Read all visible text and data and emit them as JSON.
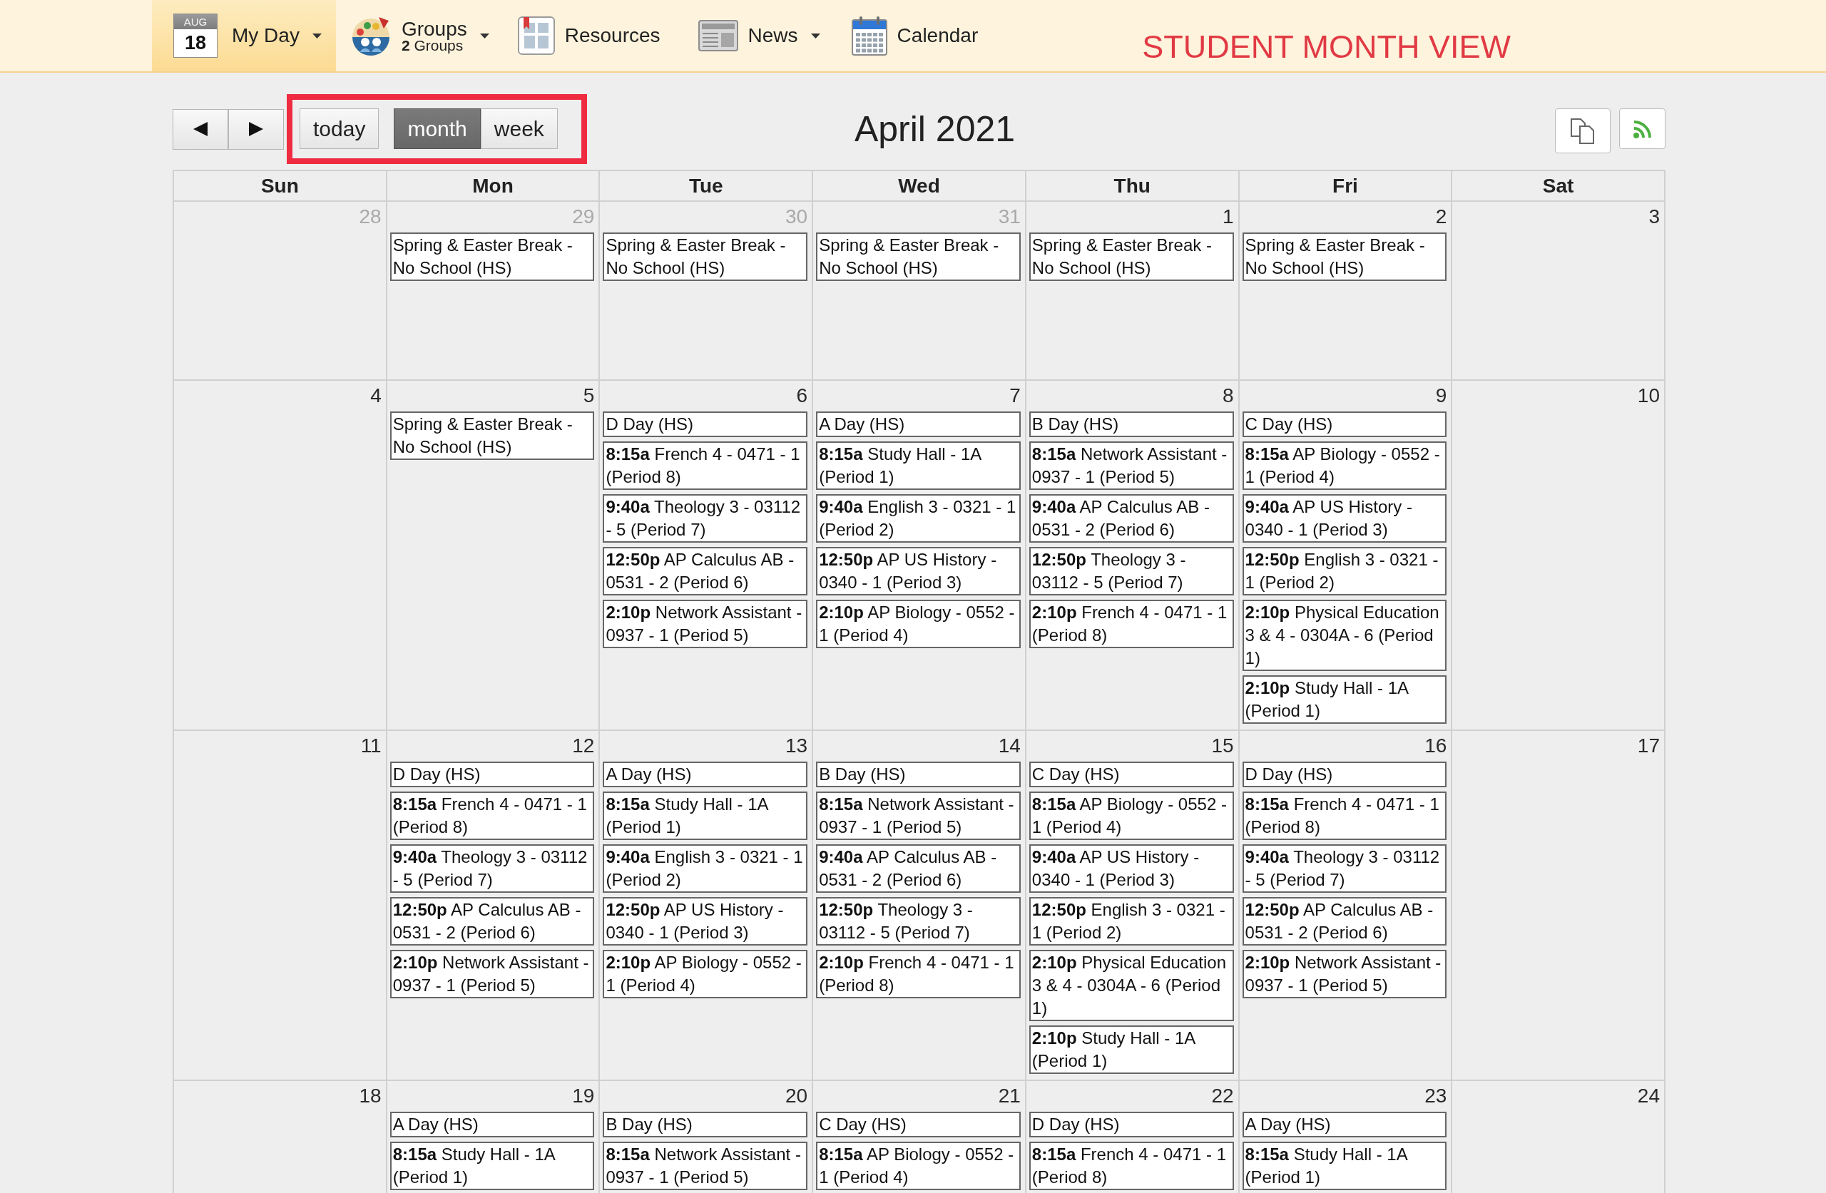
{
  "nav": [
    {
      "kind": "date",
      "badge_month": "AUG",
      "badge_day": "18",
      "label": "My Day",
      "dropdown": true,
      "selected": true
    },
    {
      "kind": "groups",
      "label": "Groups",
      "sublabel": "**2** Groups",
      "dropdown": true,
      "selected": false
    },
    {
      "kind": "resources",
      "label": "Resources",
      "dropdown": false,
      "selected": false
    },
    {
      "kind": "news",
      "label": "News",
      "dropdown": true,
      "selected": false
    },
    {
      "kind": "calendar",
      "label": "Calendar",
      "dropdown": false,
      "selected": false
    }
  ],
  "page_label": "STUDENT MONTH VIEW",
  "toolbar": {
    "today": "today",
    "views": [
      {
        "label": "month",
        "selected": true
      },
      {
        "label": "week",
        "selected": false
      }
    ],
    "highlighted": true,
    "title": "April 2021",
    "tools": [
      {
        "kind": "copy"
      },
      {
        "kind": "feed"
      }
    ]
  },
  "calendar": {
    "weekdays": [
      "Sun",
      "Mon",
      "Tue",
      "Wed",
      "Thu",
      "Fri",
      "Sat"
    ],
    "weeks": [
      {
        "days": [
          {
            "number": "28",
            "other_month": true
          },
          {
            "number": "29",
            "other_month": true,
            "events": [
              {
                "title": "Spring & Easter Break - No School (HS)"
              }
            ]
          },
          {
            "number": "30",
            "other_month": true,
            "events": [
              {
                "title": "Spring & Easter Break - No School (HS)"
              }
            ]
          },
          {
            "number": "31",
            "other_month": true,
            "events": [
              {
                "title": "Spring & Easter Break - No School (HS)"
              }
            ]
          },
          {
            "number": "1",
            "other_month": false,
            "events": [
              {
                "title": "Spring & Easter Break - No School (HS)"
              }
            ]
          },
          {
            "number": "2",
            "other_month": false,
            "events": [
              {
                "title": "Spring & Easter Break - No School (HS)"
              }
            ]
          },
          {
            "number": "3",
            "other_month": false
          }
        ]
      },
      {
        "days": [
          {
            "number": "4",
            "other_month": false
          },
          {
            "number": "5",
            "other_month": false,
            "events": [
              {
                "title": "Spring & Easter Break - No School (HS)"
              }
            ]
          },
          {
            "number": "6",
            "other_month": false,
            "events": [
              {
                "title": "D Day (HS)"
              },
              {
                "time": "8:15a",
                "title": "French 4 - 0471 - 1 (Period 8)"
              },
              {
                "time": "9:40a",
                "title": "Theology 3 - 03112 - 5 (Period 7)"
              },
              {
                "time": "12:50p",
                "title": "AP Calculus AB - 0531 - 2 (Period 6)"
              },
              {
                "time": "2:10p",
                "title": "Network Assistant - 0937 - 1 (Period 5)"
              }
            ]
          },
          {
            "number": "7",
            "other_month": false,
            "events": [
              {
                "title": "A Day (HS)"
              },
              {
                "time": "8:15a",
                "title": "Study Hall - 1A (Period 1)"
              },
              {
                "time": "9:40a",
                "title": "English 3 - 0321 - 1 (Period 2)"
              },
              {
                "time": "12:50p",
                "title": "AP US History - 0340 - 1 (Period 3)"
              },
              {
                "time": "2:10p",
                "title": "AP Biology - 0552 - 1 (Period 4)"
              }
            ]
          },
          {
            "number": "8",
            "other_month": false,
            "events": [
              {
                "title": "B Day (HS)"
              },
              {
                "time": "8:15a",
                "title": "Network Assistant - 0937 - 1 (Period 5)"
              },
              {
                "time": "9:40a",
                "title": "AP Calculus AB - 0531 - 2 (Period 6)"
              },
              {
                "time": "12:50p",
                "title": "Theology 3 - 03112 - 5 (Period 7)"
              },
              {
                "time": "2:10p",
                "title": "French 4 - 0471 - 1 (Period 8)"
              }
            ]
          },
          {
            "number": "9",
            "other_month": false,
            "events": [
              {
                "title": "C Day (HS)"
              },
              {
                "time": "8:15a",
                "title": "AP Biology - 0552 - 1 (Period 4)"
              },
              {
                "time": "9:40a",
                "title": "AP US History - 0340 - 1 (Period 3)"
              },
              {
                "time": "12:50p",
                "title": "English 3 - 0321 - 1 (Period 2)"
              },
              {
                "time": "2:10p",
                "title": "Physical Education 3 & 4 - 0304A - 6 (Period 1)"
              },
              {
                "time": "2:10p",
                "title": "Study Hall - 1A (Period 1)"
              }
            ]
          },
          {
            "number": "10",
            "other_month": false
          }
        ]
      },
      {
        "days": [
          {
            "number": "11",
            "other_month": false
          },
          {
            "number": "12",
            "other_month": false,
            "events": [
              {
                "title": "D Day (HS)"
              },
              {
                "time": "8:15a",
                "title": "French 4 - 0471 - 1 (Period 8)"
              },
              {
                "time": "9:40a",
                "title": "Theology 3 - 03112 - 5 (Period 7)"
              },
              {
                "time": "12:50p",
                "title": "AP Calculus AB - 0531 - 2 (Period 6)"
              },
              {
                "time": "2:10p",
                "title": "Network Assistant - 0937 - 1 (Period 5)"
              }
            ]
          },
          {
            "number": "13",
            "other_month": false,
            "events": [
              {
                "title": "A Day (HS)"
              },
              {
                "time": "8:15a",
                "title": "Study Hall - 1A (Period 1)"
              },
              {
                "time": "9:40a",
                "title": "English 3 - 0321 - 1 (Period 2)"
              },
              {
                "time": "12:50p",
                "title": "AP US History - 0340 - 1 (Period 3)"
              },
              {
                "time": "2:10p",
                "title": "AP Biology - 0552 - 1 (Period 4)"
              }
            ]
          },
          {
            "number": "14",
            "other_month": false,
            "events": [
              {
                "title": "B Day (HS)"
              },
              {
                "time": "8:15a",
                "title": "Network Assistant - 0937 - 1 (Period 5)"
              },
              {
                "time": "9:40a",
                "title": "AP Calculus AB - 0531 - 2 (Period 6)"
              },
              {
                "time": "12:50p",
                "title": "Theology 3 - 03112 - 5 (Period 7)"
              },
              {
                "time": "2:10p",
                "title": "French 4 - 0471 - 1 (Period 8)"
              }
            ]
          },
          {
            "number": "15",
            "other_month": false,
            "events": [
              {
                "title": "C Day (HS)"
              },
              {
                "time": "8:15a",
                "title": "AP Biology - 0552 - 1 (Period 4)"
              },
              {
                "time": "9:40a",
                "title": "AP US History - 0340 - 1 (Period 3)"
              },
              {
                "time": "12:50p",
                "title": "English 3 - 0321 - 1 (Period 2)"
              },
              {
                "time": "2:10p",
                "title": "Physical Education 3 & 4 - 0304A - 6 (Period 1)"
              },
              {
                "time": "2:10p",
                "title": "Study Hall - 1A (Period 1)"
              }
            ]
          },
          {
            "number": "16",
            "other_month": false,
            "events": [
              {
                "title": "D Day (HS)"
              },
              {
                "time": "8:15a",
                "title": "French 4 - 0471 - 1 (Period 8)"
              },
              {
                "time": "9:40a",
                "title": "Theology 3 - 03112 - 5 (Period 7)"
              },
              {
                "time": "12:50p",
                "title": "AP Calculus AB - 0531 - 2 (Period 6)"
              },
              {
                "time": "2:10p",
                "title": "Network Assistant - 0937 - 1 (Period 5)"
              }
            ]
          },
          {
            "number": "17",
            "other_month": false
          }
        ]
      },
      {
        "days": [
          {
            "number": "18",
            "other_month": false
          },
          {
            "number": "19",
            "other_month": false,
            "events": [
              {
                "title": "A Day (HS)"
              },
              {
                "time": "8:15a",
                "title": "Study Hall - 1A (Period 1)"
              }
            ]
          },
          {
            "number": "20",
            "other_month": false,
            "events": [
              {
                "title": "B Day (HS)"
              },
              {
                "time": "8:15a",
                "title": "Network Assistant - 0937 - 1 (Period 5)"
              }
            ]
          },
          {
            "number": "21",
            "other_month": false,
            "events": [
              {
                "title": "C Day (HS)"
              },
              {
                "time": "8:15a",
                "title": "AP Biology - 0552 - 1 (Period 4)"
              }
            ]
          },
          {
            "number": "22",
            "other_month": false,
            "events": [
              {
                "title": "D Day (HS)"
              },
              {
                "time": "8:15a",
                "title": "French 4 - 0471 - 1 (Period 8)"
              }
            ]
          },
          {
            "number": "23",
            "other_month": false,
            "events": [
              {
                "title": "A Day (HS)"
              },
              {
                "time": "8:15a",
                "title": "Study Hall - 1A (Period 1)"
              }
            ]
          },
          {
            "number": "24",
            "other_month": false
          }
        ]
      }
    ]
  }
}
